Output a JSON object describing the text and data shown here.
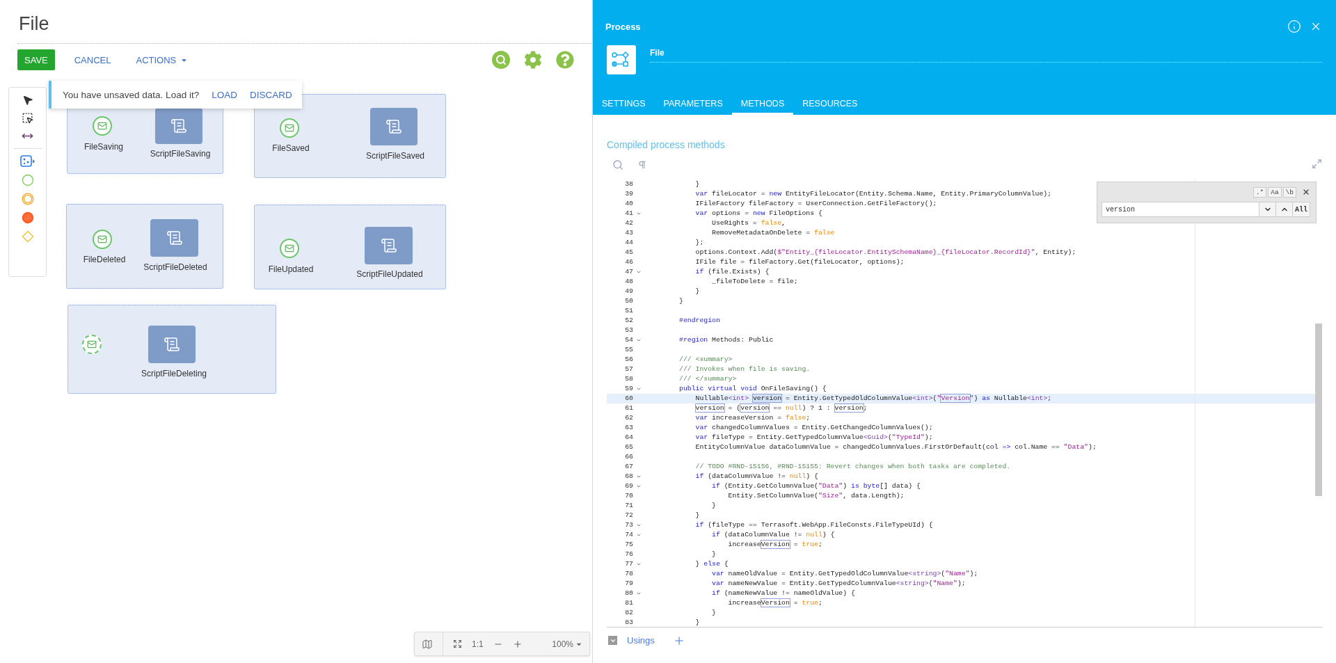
{
  "page": {
    "title": "File"
  },
  "toolbar": {
    "buttons": [
      {
        "label": "SAVE",
        "kind": "primary"
      },
      {
        "label": "CANCEL",
        "kind": "link"
      },
      {
        "label": "ACTIONS",
        "kind": "menu"
      }
    ]
  },
  "notice": {
    "text": "You have unsaved data. Load it?",
    "actions": [
      "LOAD",
      "DISCARD"
    ]
  },
  "diagram": {
    "groups": [
      {
        "event": {
          "label": "FileSaving",
          "interrupting": true
        },
        "task": {
          "label": "ScriptFileSaving"
        }
      },
      {
        "event": {
          "label": "FileSaved",
          "interrupting": true
        },
        "task": {
          "label": "ScriptFileSaved"
        }
      },
      {
        "event": {
          "label": "FileDeleted",
          "interrupting": true
        },
        "task": {
          "label": "ScriptFileDeleted"
        }
      },
      {
        "event": {
          "label": "FileUpdated",
          "interrupting": true
        },
        "task": {
          "label": "ScriptFileUpdated"
        }
      },
      {
        "event": {
          "interrupting": false
        },
        "task": {
          "label": "ScriptFileDeleting"
        }
      }
    ]
  },
  "zoom_bar": {
    "ratio": "1:1",
    "zoom": "100%"
  },
  "panel": {
    "title": "Process",
    "name": "File",
    "tabs": [
      {
        "label": "SETTINGS",
        "selected": false
      },
      {
        "label": "PARAMETERS",
        "selected": false
      },
      {
        "label": "METHODS",
        "selected": true
      },
      {
        "label": "RESOURCES",
        "selected": false
      }
    ],
    "section_title": "Compiled process methods",
    "editor": {
      "search": {
        "value": "version",
        "all": "All",
        "options": [
          {
            "label": ".*",
            "selected": false
          },
          {
            "label": "Aa",
            "selected": false
          },
          {
            "label": "\\b",
            "selected": false
          }
        ]
      },
      "lines": [
        {
          "number": "38",
          "foldable": false,
          "current": false,
          "tokens": [
            {
              "text": "            }"
            }
          ]
        },
        {
          "number": "39",
          "foldable": false,
          "current": false,
          "tokens": [
            {
              "text": "            var",
              "kind": "keyword"
            },
            {
              "text": " fileLocator = "
            },
            {
              "text": "new",
              "kind": "keyword"
            },
            {
              "text": " EntityFileLocator(Entity.Schema.Name, Entity.PrimaryColumnValue);"
            }
          ]
        },
        {
          "number": "40",
          "foldable": false,
          "current": false,
          "tokens": [
            {
              "text": "            IFileFactory fileFactory = UserConnection.GetFileFactory();"
            }
          ]
        },
        {
          "number": "41",
          "foldable": true,
          "current": false,
          "tokens": [
            {
              "text": "            var",
              "kind": "keyword"
            },
            {
              "text": " options = "
            },
            {
              "text": "new",
              "kind": "keyword"
            },
            {
              "text": " FileOptions {"
            }
          ]
        },
        {
          "number": "42",
          "foldable": false,
          "current": false,
          "tokens": [
            {
              "text": "                UseRights = "
            },
            {
              "text": "false",
              "kind": "literal"
            },
            {
              "text": ","
            }
          ]
        },
        {
          "number": "43",
          "foldable": false,
          "current": false,
          "tokens": [
            {
              "text": "                RemoveMetadataOnDelete = "
            },
            {
              "text": "false",
              "kind": "literal"
            }
          ]
        },
        {
          "number": "44",
          "foldable": false,
          "current": false,
          "tokens": [
            {
              "text": "            };"
            }
          ]
        },
        {
          "number": "45",
          "foldable": false,
          "current": false,
          "tokens": [
            {
              "text": "            options.Context.Add("
            },
            {
              "text": "$\"Entity_{fileLocator.EntitySchemaName}_{fileLocator.RecordId}\"",
              "kind": "string"
            },
            {
              "text": ", Entity);"
            }
          ]
        },
        {
          "number": "46",
          "foldable": false,
          "current": false,
          "tokens": [
            {
              "text": "            IFile file = fileFactory.Get(fileLocator, options);"
            }
          ]
        },
        {
          "number": "47",
          "foldable": true,
          "current": false,
          "tokens": [
            {
              "text": "            if",
              "kind": "keyword"
            },
            {
              "text": " (file.Exists) {"
            }
          ]
        },
        {
          "number": "48",
          "foldable": false,
          "current": false,
          "tokens": [
            {
              "text": "                _fileToDelete = file;"
            }
          ]
        },
        {
          "number": "49",
          "foldable": false,
          "current": false,
          "tokens": [
            {
              "text": "            }"
            }
          ]
        },
        {
          "number": "50",
          "foldable": false,
          "current": false,
          "tokens": [
            {
              "text": "        }"
            }
          ]
        },
        {
          "number": "51",
          "foldable": false,
          "current": false
        },
        {
          "number": "52",
          "foldable": false,
          "current": false,
          "tokens": [
            {
              "text": "        #endregion",
              "kind": "keyword"
            }
          ]
        },
        {
          "number": "53",
          "foldable": false,
          "current": false
        },
        {
          "number": "54",
          "foldable": true,
          "current": false,
          "tokens": [
            {
              "text": "        #region",
              "kind": "keyword"
            },
            {
              "text": " Methods: Public"
            }
          ]
        },
        {
          "number": "55",
          "foldable": false,
          "current": false
        },
        {
          "number": "56",
          "foldable": false,
          "current": false,
          "tokens": [
            {
              "text": "        /// <summary>",
              "kind": "comment"
            }
          ]
        },
        {
          "number": "57",
          "foldable": false,
          "current": false,
          "tokens": [
            {
              "text": "        /// Invokes when file is saving.",
              "kind": "comment"
            }
          ]
        },
        {
          "number": "58",
          "foldable": false,
          "current": false,
          "tokens": [
            {
              "text": "        /// </summary>",
              "kind": "comment"
            }
          ]
        },
        {
          "number": "59",
          "foldable": true,
          "current": false,
          "tokens": [
            {
              "text": "        public virtual void",
              "kind": "keyword"
            },
            {
              "text": " OnFileSaving() {"
            }
          ]
        },
        {
          "number": "60",
          "foldable": false,
          "current": true,
          "tokens": [
            {
              "text": "            Nullable"
            },
            {
              "text": "<int> ",
              "kind": "type"
            },
            {
              "text": "version",
              "kind": "match_current"
            },
            {
              "text": " = Entity.GetTypedOldColumnValue"
            },
            {
              "text": "<int>",
              "kind": "type"
            },
            {
              "text": "("
            },
            {
              "text": "\"",
              "kind": "string"
            },
            {
              "text": "Version",
              "kind": "string_match"
            },
            {
              "text": "\"",
              "kind": "string"
            },
            {
              "text": ") "
            },
            {
              "text": "as",
              "kind": "keyword"
            },
            {
              "text": " Nullable"
            },
            {
              "text": "<int>",
              "kind": "type"
            },
            {
              "text": ";"
            }
          ]
        },
        {
          "number": "61",
          "foldable": false,
          "current": false,
          "tokens": [
            {
              "text": "            version",
              "kind": "match"
            },
            {
              "text": " = ("
            },
            {
              "text": "version",
              "kind": "match"
            },
            {
              "text": " == "
            },
            {
              "text": "null",
              "kind": "literal"
            },
            {
              "text": ") ? 1 : "
            },
            {
              "text": "version",
              "kind": "match"
            },
            {
              "text": ";"
            }
          ]
        },
        {
          "number": "62",
          "foldable": false,
          "current": false,
          "tokens": [
            {
              "text": "            var",
              "kind": "keyword"
            },
            {
              "text": " increaseVersion = "
            },
            {
              "text": "false",
              "kind": "literal"
            },
            {
              "text": ";"
            }
          ]
        },
        {
          "number": "63",
          "foldable": false,
          "current": false,
          "tokens": [
            {
              "text": "            var",
              "kind": "keyword"
            },
            {
              "text": " changedColumnValues = Entity.GetChangedColumnValues();"
            }
          ]
        },
        {
          "number": "64",
          "foldable": false,
          "current": false,
          "tokens": [
            {
              "text": "            var",
              "kind": "keyword"
            },
            {
              "text": " fileType = Entity.GetTypedColumnValue"
            },
            {
              "text": "<Guid>",
              "kind": "type"
            },
            {
              "text": "("
            },
            {
              "text": "\"TypeId\"",
              "kind": "string"
            },
            {
              "text": ");"
            }
          ]
        },
        {
          "number": "65",
          "foldable": false,
          "current": false,
          "tokens": [
            {
              "text": "            EntityColumnValue dataColumnValue = changedColumnValues.FirstOrDefault(col "
            },
            {
              "text": "=>",
              "kind": "keyword"
            },
            {
              "text": " col.Name == "
            },
            {
              "text": "\"Data\"",
              "kind": "string"
            },
            {
              "text": ");"
            }
          ]
        },
        {
          "number": "66",
          "foldable": false,
          "current": false
        },
        {
          "number": "67",
          "foldable": false,
          "current": false,
          "tokens": [
            {
              "text": "            // TODO #RND-15156, #RND-15155: Revert changes when both tasks are completed.",
              "kind": "comment"
            }
          ]
        },
        {
          "number": "68",
          "foldable": true,
          "current": false,
          "tokens": [
            {
              "text": "            if",
              "kind": "keyword"
            },
            {
              "text": " (dataColumnValue != "
            },
            {
              "text": "null",
              "kind": "literal"
            },
            {
              "text": ") {"
            }
          ]
        },
        {
          "number": "69",
          "foldable": true,
          "current": false,
          "tokens": [
            {
              "text": "                if",
              "kind": "keyword"
            },
            {
              "text": " (Entity.GetColumnValue("
            },
            {
              "text": "\"Data\"",
              "kind": "string"
            },
            {
              "text": ") "
            },
            {
              "text": "is byte",
              "kind": "keyword"
            },
            {
              "text": "[] data) {"
            }
          ]
        },
        {
          "number": "70",
          "foldable": false,
          "current": false,
          "tokens": [
            {
              "text": "                    Entity.SetColumnValue("
            },
            {
              "text": "\"Size\"",
              "kind": "string"
            },
            {
              "text": ", data.Length);"
            }
          ]
        },
        {
          "number": "71",
          "foldable": false,
          "current": false,
          "tokens": [
            {
              "text": "                }"
            }
          ]
        },
        {
          "number": "72",
          "foldable": false,
          "current": false,
          "tokens": [
            {
              "text": "            }"
            }
          ]
        },
        {
          "number": "73",
          "foldable": true,
          "current": false,
          "tokens": [
            {
              "text": "            if",
              "kind": "keyword"
            },
            {
              "text": " (fileType == Terrasoft.WebApp.FileConsts.FileTypeUId) {"
            }
          ]
        },
        {
          "number": "74",
          "foldable": true,
          "current": false,
          "tokens": [
            {
              "text": "                if",
              "kind": "keyword"
            },
            {
              "text": " (dataColumnValue != "
            },
            {
              "text": "null",
              "kind": "literal"
            },
            {
              "text": ") {"
            }
          ]
        },
        {
          "number": "75",
          "foldable": false,
          "current": false,
          "tokens": [
            {
              "text": "                    increase"
            },
            {
              "text": "Version",
              "kind": "match"
            },
            {
              "text": " = "
            },
            {
              "text": "true",
              "kind": "literal"
            },
            {
              "text": ";"
            }
          ]
        },
        {
          "number": "76",
          "foldable": false,
          "current": false,
          "tokens": [
            {
              "text": "                }"
            }
          ]
        },
        {
          "number": "77",
          "foldable": true,
          "current": false,
          "tokens": [
            {
              "text": "            } "
            },
            {
              "text": "else",
              "kind": "keyword"
            },
            {
              "text": " {"
            }
          ]
        },
        {
          "number": "78",
          "foldable": false,
          "current": false,
          "tokens": [
            {
              "text": "                var",
              "kind": "keyword"
            },
            {
              "text": " nameOldValue = Entity.GetTypedOldColumnValue"
            },
            {
              "text": "<string>",
              "kind": "type"
            },
            {
              "text": "("
            },
            {
              "text": "\"Name\"",
              "kind": "string"
            },
            {
              "text": ");"
            }
          ]
        },
        {
          "number": "79",
          "foldable": false,
          "current": false,
          "tokens": [
            {
              "text": "                var",
              "kind": "keyword"
            },
            {
              "text": " nameNewValue = Entity.GetTypedColumnValue"
            },
            {
              "text": "<string>",
              "kind": "type"
            },
            {
              "text": "("
            },
            {
              "text": "\"Name\"",
              "kind": "string"
            },
            {
              "text": ");"
            }
          ]
        },
        {
          "number": "80",
          "foldable": true,
          "current": false,
          "tokens": [
            {
              "text": "                if",
              "kind": "keyword"
            },
            {
              "text": " (nameNewValue != nameOldValue) {"
            }
          ]
        },
        {
          "number": "81",
          "foldable": false,
          "current": false,
          "tokens": [
            {
              "text": "                    increase"
            },
            {
              "text": "Version",
              "kind": "match"
            },
            {
              "text": " = "
            },
            {
              "text": "true",
              "kind": "literal"
            },
            {
              "text": ";"
            }
          ]
        },
        {
          "number": "82",
          "foldable": false,
          "current": false,
          "tokens": [
            {
              "text": "                }"
            }
          ]
        },
        {
          "number": "83",
          "foldable": false,
          "current": false,
          "tokens": [
            {
              "text": "            }"
            }
          ]
        }
      ]
    },
    "usings": {
      "label": "Usings"
    }
  }
}
